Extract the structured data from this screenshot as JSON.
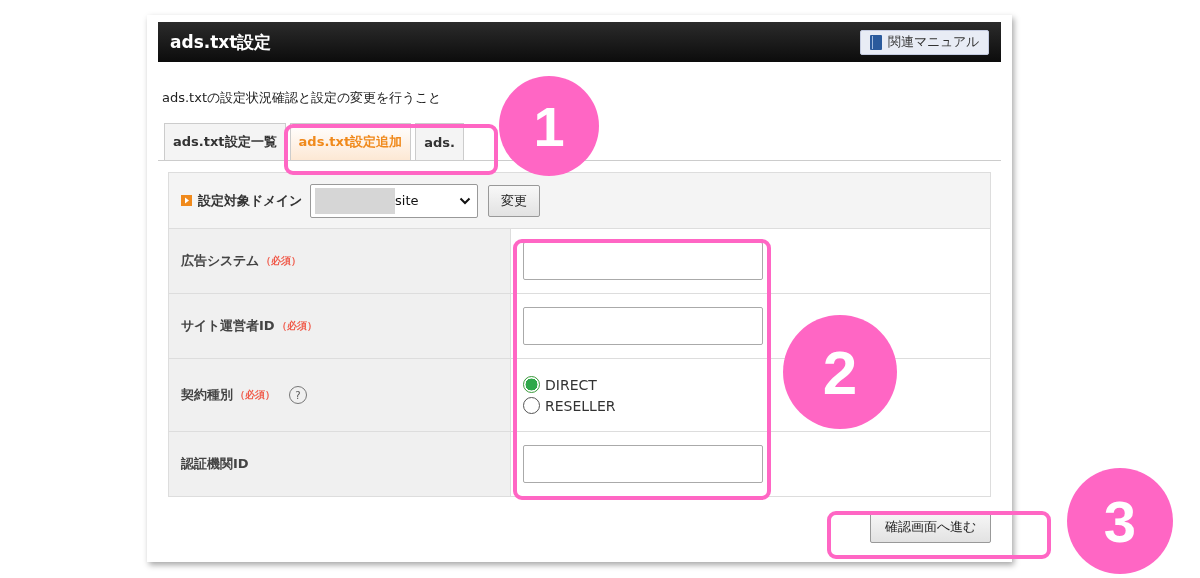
{
  "header": {
    "title": "ads.txt設定",
    "manual_button": "関連マニュアル"
  },
  "description": "ads.txtの設定状況確認と設定の変更を行うこと",
  "tabs": [
    {
      "label": "ads.txt設定一覧",
      "selected": false
    },
    {
      "label": "ads.txt設定追加",
      "selected": true
    },
    {
      "label": "ads.",
      "selected": false
    }
  ],
  "domain": {
    "label": "設定対象ドメイン",
    "value": "site",
    "button": "変更"
  },
  "fields": [
    {
      "kind": "text",
      "label": "広告システム",
      "required": "（必須）"
    },
    {
      "kind": "text",
      "label": "サイト運営者ID",
      "required": "（必須）"
    },
    {
      "kind": "radio",
      "label": "契約種別",
      "required": "（必須）",
      "help": "?",
      "options": [
        {
          "label": "DIRECT",
          "selected": true
        },
        {
          "label": "RESELLER",
          "selected": false
        }
      ]
    },
    {
      "kind": "text",
      "label": "認証機関ID"
    }
  ],
  "submit": "確認画面へ進む",
  "callouts": [
    {
      "number": "1"
    },
    {
      "number": "2"
    },
    {
      "number": "3"
    }
  ]
}
